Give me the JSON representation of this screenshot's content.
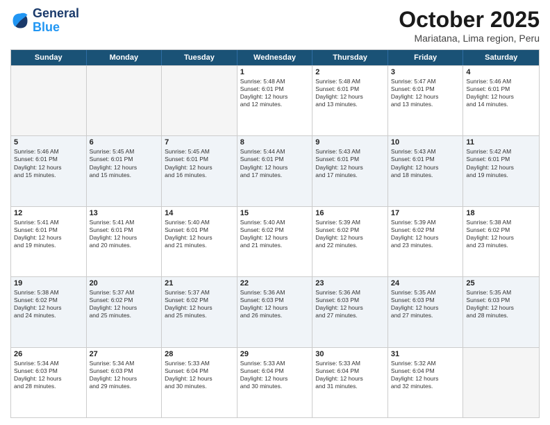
{
  "logo": {
    "line1": "General",
    "line2": "Blue"
  },
  "title": "October 2025",
  "subtitle": "Mariatana, Lima region, Peru",
  "header": {
    "days": [
      "Sunday",
      "Monday",
      "Tuesday",
      "Wednesday",
      "Thursday",
      "Friday",
      "Saturday"
    ]
  },
  "weeks": [
    {
      "cells": [
        {
          "day": "",
          "info": ""
        },
        {
          "day": "",
          "info": ""
        },
        {
          "day": "",
          "info": ""
        },
        {
          "day": "1",
          "info": "Sunrise: 5:48 AM\nSunset: 6:01 PM\nDaylight: 12 hours\nand 12 minutes."
        },
        {
          "day": "2",
          "info": "Sunrise: 5:48 AM\nSunset: 6:01 PM\nDaylight: 12 hours\nand 13 minutes."
        },
        {
          "day": "3",
          "info": "Sunrise: 5:47 AM\nSunset: 6:01 PM\nDaylight: 12 hours\nand 13 minutes."
        },
        {
          "day": "4",
          "info": "Sunrise: 5:46 AM\nSunset: 6:01 PM\nDaylight: 12 hours\nand 14 minutes."
        }
      ]
    },
    {
      "cells": [
        {
          "day": "5",
          "info": "Sunrise: 5:46 AM\nSunset: 6:01 PM\nDaylight: 12 hours\nand 15 minutes."
        },
        {
          "day": "6",
          "info": "Sunrise: 5:45 AM\nSunset: 6:01 PM\nDaylight: 12 hours\nand 15 minutes."
        },
        {
          "day": "7",
          "info": "Sunrise: 5:45 AM\nSunset: 6:01 PM\nDaylight: 12 hours\nand 16 minutes."
        },
        {
          "day": "8",
          "info": "Sunrise: 5:44 AM\nSunset: 6:01 PM\nDaylight: 12 hours\nand 17 minutes."
        },
        {
          "day": "9",
          "info": "Sunrise: 5:43 AM\nSunset: 6:01 PM\nDaylight: 12 hours\nand 17 minutes."
        },
        {
          "day": "10",
          "info": "Sunrise: 5:43 AM\nSunset: 6:01 PM\nDaylight: 12 hours\nand 18 minutes."
        },
        {
          "day": "11",
          "info": "Sunrise: 5:42 AM\nSunset: 6:01 PM\nDaylight: 12 hours\nand 19 minutes."
        }
      ]
    },
    {
      "cells": [
        {
          "day": "12",
          "info": "Sunrise: 5:41 AM\nSunset: 6:01 PM\nDaylight: 12 hours\nand 19 minutes."
        },
        {
          "day": "13",
          "info": "Sunrise: 5:41 AM\nSunset: 6:01 PM\nDaylight: 12 hours\nand 20 minutes."
        },
        {
          "day": "14",
          "info": "Sunrise: 5:40 AM\nSunset: 6:01 PM\nDaylight: 12 hours\nand 21 minutes."
        },
        {
          "day": "15",
          "info": "Sunrise: 5:40 AM\nSunset: 6:02 PM\nDaylight: 12 hours\nand 21 minutes."
        },
        {
          "day": "16",
          "info": "Sunrise: 5:39 AM\nSunset: 6:02 PM\nDaylight: 12 hours\nand 22 minutes."
        },
        {
          "day": "17",
          "info": "Sunrise: 5:39 AM\nSunset: 6:02 PM\nDaylight: 12 hours\nand 23 minutes."
        },
        {
          "day": "18",
          "info": "Sunrise: 5:38 AM\nSunset: 6:02 PM\nDaylight: 12 hours\nand 23 minutes."
        }
      ]
    },
    {
      "cells": [
        {
          "day": "19",
          "info": "Sunrise: 5:38 AM\nSunset: 6:02 PM\nDaylight: 12 hours\nand 24 minutes."
        },
        {
          "day": "20",
          "info": "Sunrise: 5:37 AM\nSunset: 6:02 PM\nDaylight: 12 hours\nand 25 minutes."
        },
        {
          "day": "21",
          "info": "Sunrise: 5:37 AM\nSunset: 6:02 PM\nDaylight: 12 hours\nand 25 minutes."
        },
        {
          "day": "22",
          "info": "Sunrise: 5:36 AM\nSunset: 6:03 PM\nDaylight: 12 hours\nand 26 minutes."
        },
        {
          "day": "23",
          "info": "Sunrise: 5:36 AM\nSunset: 6:03 PM\nDaylight: 12 hours\nand 27 minutes."
        },
        {
          "day": "24",
          "info": "Sunrise: 5:35 AM\nSunset: 6:03 PM\nDaylight: 12 hours\nand 27 minutes."
        },
        {
          "day": "25",
          "info": "Sunrise: 5:35 AM\nSunset: 6:03 PM\nDaylight: 12 hours\nand 28 minutes."
        }
      ]
    },
    {
      "cells": [
        {
          "day": "26",
          "info": "Sunrise: 5:34 AM\nSunset: 6:03 PM\nDaylight: 12 hours\nand 28 minutes."
        },
        {
          "day": "27",
          "info": "Sunrise: 5:34 AM\nSunset: 6:03 PM\nDaylight: 12 hours\nand 29 minutes."
        },
        {
          "day": "28",
          "info": "Sunrise: 5:33 AM\nSunset: 6:04 PM\nDaylight: 12 hours\nand 30 minutes."
        },
        {
          "day": "29",
          "info": "Sunrise: 5:33 AM\nSunset: 6:04 PM\nDaylight: 12 hours\nand 30 minutes."
        },
        {
          "day": "30",
          "info": "Sunrise: 5:33 AM\nSunset: 6:04 PM\nDaylight: 12 hours\nand 31 minutes."
        },
        {
          "day": "31",
          "info": "Sunrise: 5:32 AM\nSunset: 6:04 PM\nDaylight: 12 hours\nand 32 minutes."
        },
        {
          "day": "",
          "info": ""
        }
      ]
    }
  ]
}
